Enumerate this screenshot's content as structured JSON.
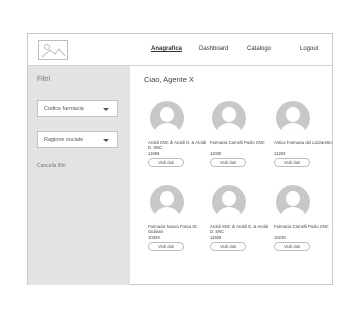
{
  "header": {
    "logo_icon": "image-placeholder-icon",
    "nav": [
      {
        "label": "Anagrafica",
        "active": true
      },
      {
        "label": "Dashboard",
        "active": false
      },
      {
        "label": "Catalogo",
        "active": false
      },
      {
        "label": "Logout",
        "active": false
      }
    ]
  },
  "sidebar": {
    "title": "Filtri",
    "filters": [
      {
        "label": "Codice farmacia",
        "icon": "caret-down-icon"
      },
      {
        "label": "Ragione sociale",
        "icon": "caret-down-icon"
      }
    ],
    "clear_label": "Cancella filtri"
  },
  "main": {
    "greeting": "Ciao, Agente X",
    "cards": [
      {
        "name": "Aroldi SNC di Aroldi G. & Aroldi D. SNC",
        "code": "11669",
        "button": "Vedi dati"
      },
      {
        "name": "Farmacia Carnelli Paolo SNC",
        "code": "11030",
        "button": "Vedi dati"
      },
      {
        "name": "Antica Farmacia del Lazzaretto",
        "code": "11263",
        "button": "Vedi dati"
      },
      {
        "name": "Farmacia Nuova Fosca Dr. Giuliano",
        "code": "10328",
        "button": "Vedi dati"
      },
      {
        "name": "Aroldi SNC di Aroldi G. & Aroldi D. SNC",
        "code": "11928",
        "button": "Vedi dati"
      },
      {
        "name": "Farmacia Carnelli Paolo SNC",
        "code": "10239",
        "button": "Vedi dati"
      }
    ]
  },
  "colors": {
    "sidebar_bg": "#e3e3e3",
    "avatar": "#c8c8c8",
    "border": "#c9c9c9"
  }
}
